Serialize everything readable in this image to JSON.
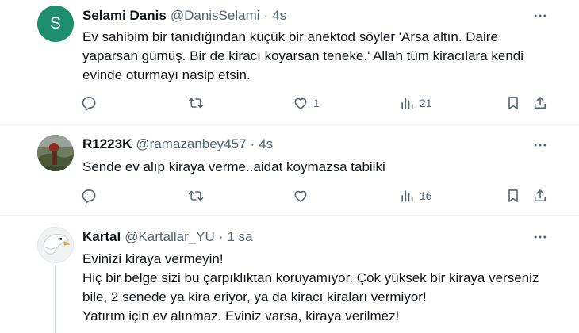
{
  "tweets": [
    {
      "avatar_letter": "S",
      "name": "Selami Danis",
      "handle": "@DanisSelami",
      "separator": "·",
      "time": "4s",
      "lines": [
        "Ev sahibim bir tanıdığından küçük bir anektod söyler 'Arsa altın. Daire",
        "yaparsan gümüş. Bir de kiracı koyarsan teneke.' Allah tüm kiracılara kendi",
        "evinde oturmayı nasip etsin."
      ],
      "likes": "1",
      "views": "21"
    },
    {
      "name": "R1223K",
      "handle": "@ramazanbey457",
      "separator": "·",
      "time": "4s",
      "lines": [
        "Sende ev alıp kiraya verme..aidat koymazsa tabiiki"
      ],
      "views": "16"
    },
    {
      "name": "Kartal",
      "handle": "@Kartallar_YU",
      "separator": "·",
      "time": "1 sa",
      "lines": [
        "Evinizi kiraya vermeyin!",
        "Hiç bir belge sizi bu çarpıklıktan koruyamıyor. Çok yüksek bir kiraya verseniz",
        "bile, 2 senede ya kira eriyor, ya da kiracı kiraları vermiyor!",
        "Yatırım için ev alınmaz. Eviniz varsa, kiraya verilmez!"
      ]
    }
  ],
  "icons": {
    "reply": "reply-icon",
    "retweet": "retweet-icon",
    "like": "heart-icon",
    "views": "views-icon",
    "bookmark": "bookmark-icon",
    "share": "share-icon",
    "more": "more-icon"
  },
  "colors": {
    "text": "#0f1419",
    "secondary": "#536471",
    "divider": "#eff3f4",
    "avatar_bg": "#1e8f6e"
  }
}
